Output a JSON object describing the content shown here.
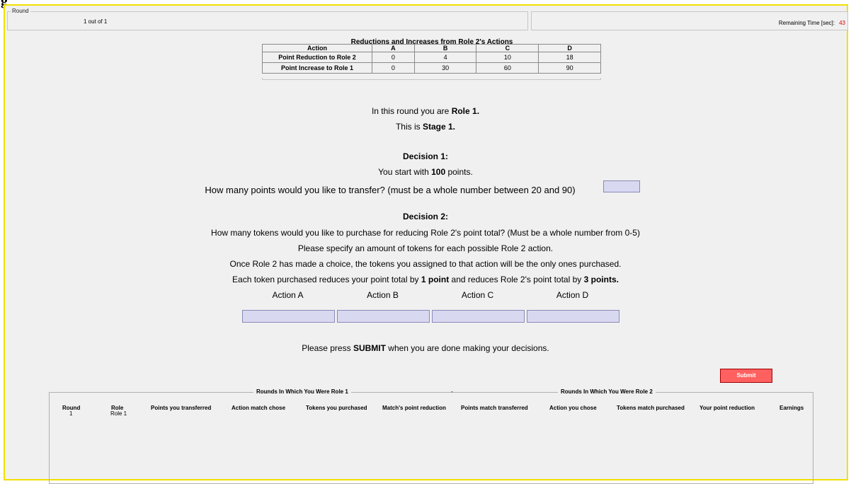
{
  "top_char": "g",
  "header": {
    "round_legend": "Round",
    "round_value": "1  out of  1",
    "time_label": "Remaining Time [sec]:",
    "time_value": "43"
  },
  "reductions_table": {
    "title": "Reductions and Increases from Role 2's Actions",
    "columns": [
      "Action",
      "A",
      "B",
      "C",
      "D"
    ],
    "rows": [
      {
        "label": "Point Reduction to Role 2",
        "values": [
          "0",
          "4",
          "10",
          "18"
        ]
      },
      {
        "label": "Point Increase to Role 1",
        "values": [
          "0",
          "30",
          "60",
          "90"
        ]
      }
    ]
  },
  "intro": {
    "role_prefix": "In this round you are ",
    "role_bold": "Role 1.",
    "stage_prefix": "This is ",
    "stage_bold": "Stage 1."
  },
  "decision1": {
    "heading": "Decision 1:",
    "start_prefix": "You start with ",
    "start_bold": "100",
    "start_suffix": " points.",
    "question": "How many points would you like to transfer? (must be a whole number between 20 and 90)",
    "input_value": ""
  },
  "decision2": {
    "heading": "Decision 2:",
    "line1": "How many tokens would you like to purchase for reducing Role 2's point total? (Must be a whole number from 0-5)",
    "line2": "Please specify an amount of tokens for each possible Role 2 action.",
    "line3": "Once Role 2 has made a choice, the tokens you assigned to that action will be the only ones purchased.",
    "line4_a": "Each token purchased reduces your point total by ",
    "line4_b": "1 point",
    "line4_c": " and reduces Role 2's point total by ",
    "line4_d": "3 points.",
    "actions": [
      "Action A",
      "Action B",
      "Action C",
      "Action D"
    ]
  },
  "submit_note": {
    "prefix": "Please press ",
    "bold": "SUBMIT",
    "suffix": " when you are done making your decisions."
  },
  "submit_label": "Submit",
  "history": {
    "legend_role1": "Rounds In Which You Were Role 1",
    "legend_dash": "-",
    "legend_role2": "Rounds In Which You Were Role 2",
    "columns": [
      "Round",
      "Role",
      "Points you transferred",
      "Action match chose",
      "Tokens you purchased",
      "Match's point reduction",
      "Points match transferred",
      "Action you chose",
      "Tokens match purchased",
      "Your point reduction",
      "Earnings"
    ],
    "row": {
      "round": "1",
      "role": "Role 1"
    }
  },
  "colors": {
    "frame_border": "#f2e000",
    "input_fill": "#d8d8f0",
    "submit_fill": "#ff6060",
    "time_value": "#e00000"
  }
}
